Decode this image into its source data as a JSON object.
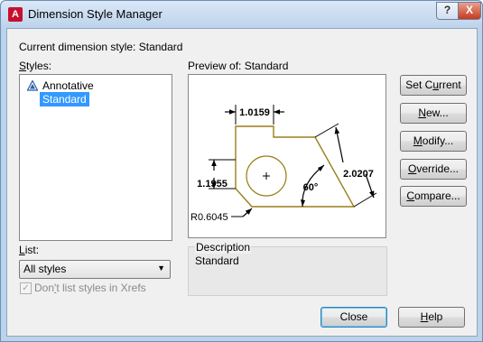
{
  "window": {
    "title": "Dimension Style Manager",
    "help_glyph": "?",
    "close_glyph": "X"
  },
  "current_style": {
    "label": "Current dimension style:",
    "value": "Standard"
  },
  "styles": {
    "label_underlined": "S",
    "label_rest": "tyles:",
    "items": [
      {
        "label": "Annotative",
        "selected": false,
        "icon": "annotative-icon"
      },
      {
        "label": "Standard",
        "selected": true
      }
    ]
  },
  "list": {
    "label_underlined": "L",
    "label_rest": "ist:",
    "selected": "All styles",
    "arrow": "▼"
  },
  "xrefs": {
    "checked": true,
    "label_prefix": "Don",
    "label_underlined": "'",
    "label_rest": "t list styles in Xrefs"
  },
  "preview": {
    "label": "Preview of: Standard",
    "dims": {
      "top": "1.0159",
      "left": "1.1955",
      "diag": "2.0207",
      "angle": "60°",
      "radius": "R0.6045"
    }
  },
  "description": {
    "label": "Description",
    "value": "Standard"
  },
  "buttons": {
    "set_current": {
      "pre": "Set C",
      "u": "u",
      "post": "rrent"
    },
    "new": {
      "pre": "",
      "u": "N",
      "post": "ew..."
    },
    "modify": {
      "pre": "",
      "u": "M",
      "post": "odify..."
    },
    "override": {
      "pre": "",
      "u": "O",
      "post": "verride..."
    },
    "compare": {
      "pre": "",
      "u": "C",
      "post": "ompare..."
    },
    "close": "Close",
    "help": {
      "pre": "",
      "u": "H",
      "post": "elp"
    }
  },
  "colors": {
    "shape_outline": "#9a7f1a",
    "selection": "#3399ff"
  }
}
